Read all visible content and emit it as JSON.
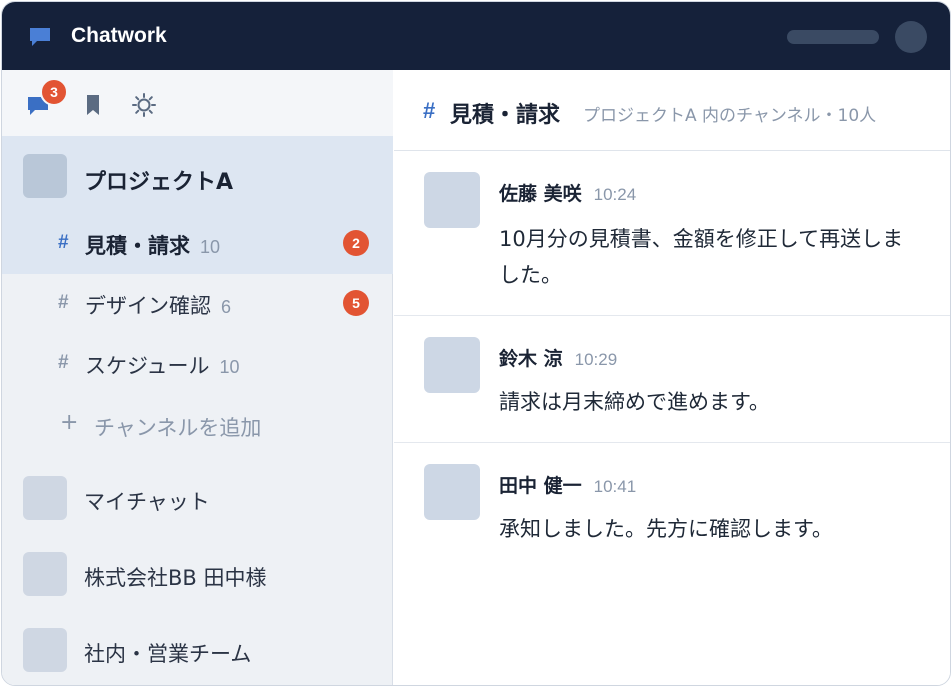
{
  "app": {
    "name": "Chatwork"
  },
  "sidebar": {
    "tabs": [
      {
        "icon": "chat-icon",
        "badge": "3"
      },
      {
        "icon": "bookmark-icon"
      },
      {
        "icon": "settings-icon"
      }
    ],
    "group": {
      "name": "プロジェクトA",
      "channels": [
        {
          "hash": "#",
          "name": "見積・請求",
          "count": "10",
          "badge": "2",
          "active": true
        },
        {
          "hash": "#",
          "name": "デザイン確認",
          "count": "6",
          "badge": "5"
        },
        {
          "hash": "#",
          "name": "スケジュール",
          "count": "10"
        }
      ],
      "add_channel": {
        "icon": "+",
        "label": "チャンネルを追加"
      }
    },
    "rooms": [
      {
        "name": "マイチャット"
      },
      {
        "name": "株式会社BB 田中様"
      },
      {
        "name": "社内・営業チーム"
      }
    ]
  },
  "main": {
    "header": {
      "hash": "#",
      "title": "見積・請求",
      "subtitle": "プロジェクトA 内のチャンネル・10人"
    },
    "messages": [
      {
        "author": "佐藤 美咲",
        "time": "10:24",
        "text": "10月分の見積書、金額を修正して再送しました。"
      },
      {
        "author": "鈴木 涼",
        "time": "10:29",
        "text": "請求は月末締めで進めます。"
      },
      {
        "author": "田中 健一",
        "time": "10:41",
        "text": "承知しました。先方に確認します。"
      }
    ]
  },
  "colors": {
    "topbar": "#15213a",
    "accent": "#3a6fc4",
    "badge": "#e25433",
    "active_row": "#dde6f2"
  }
}
